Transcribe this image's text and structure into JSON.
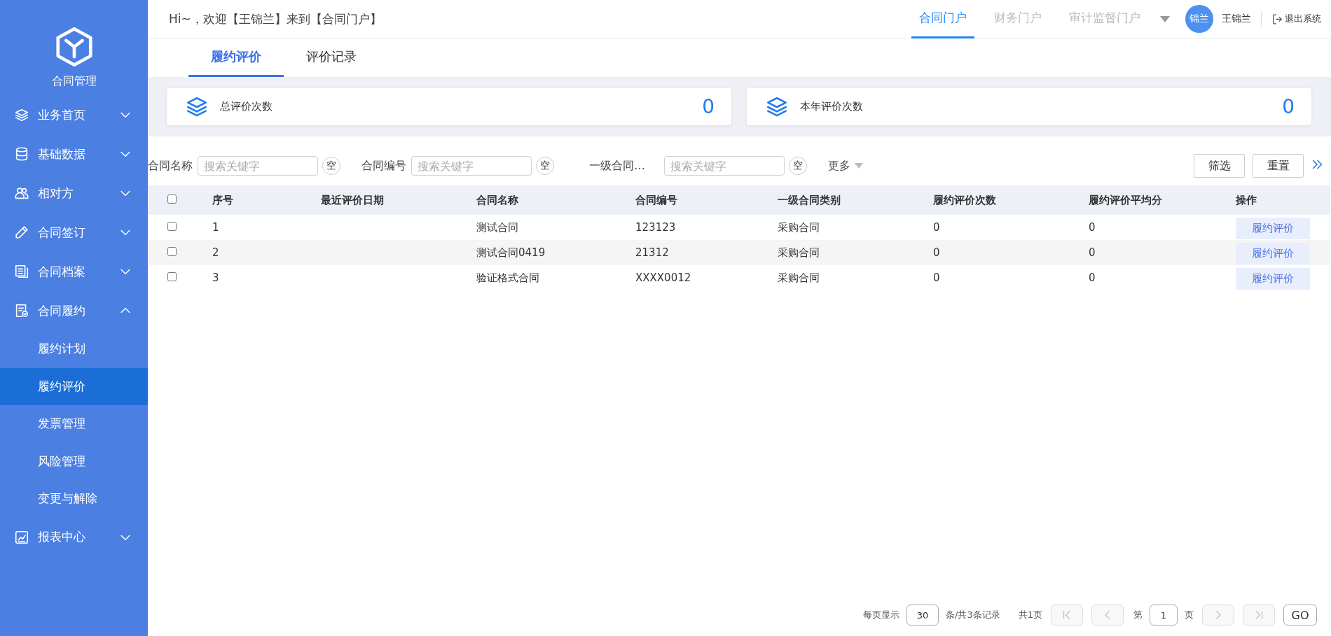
{
  "sidebar": {
    "logo_text": "合同管理",
    "items": [
      {
        "label": "业务首页",
        "expanded": false
      },
      {
        "label": "基础数据",
        "expanded": false
      },
      {
        "label": "相对方",
        "expanded": false
      },
      {
        "label": "合同签订",
        "expanded": false
      },
      {
        "label": "合同档案",
        "expanded": false
      },
      {
        "label": "合同履约",
        "expanded": true,
        "children": [
          {
            "label": "履约计划",
            "selected": false
          },
          {
            "label": "履约评价",
            "selected": true
          },
          {
            "label": "发票管理",
            "selected": false
          },
          {
            "label": "风险管理",
            "selected": false
          },
          {
            "label": "变更与解除",
            "selected": false
          }
        ]
      },
      {
        "label": "报表中心",
        "expanded": false
      }
    ]
  },
  "header": {
    "greeting": "Hi~，欢迎【王锦兰】来到【合同门户】",
    "portals": [
      {
        "label": "合同门户",
        "selected": true
      },
      {
        "label": "财务门户",
        "selected": false
      },
      {
        "label": "审计监督门户",
        "selected": false
      }
    ],
    "avatar": "锦兰",
    "user": "王锦兰",
    "logout": "退出系统"
  },
  "tabs": [
    {
      "label": "履约评价",
      "selected": true
    },
    {
      "label": "评价记录",
      "selected": false
    }
  ],
  "stats": [
    {
      "label": "总评价次数",
      "value": "0"
    },
    {
      "label": "本年评价次数",
      "value": "0"
    }
  ],
  "filters": {
    "fields": [
      {
        "label": "合同名称",
        "placeholder": "搜索关键字",
        "clear": "空"
      },
      {
        "label": "合同编号",
        "placeholder": "搜索关键字",
        "clear": "空"
      },
      {
        "label": "一级合同…",
        "placeholder": "搜索关键字",
        "clear": "空"
      }
    ],
    "more": "更多",
    "buttons": [
      "筛选",
      "重置"
    ]
  },
  "table": {
    "header_checked": false,
    "columns": [
      "序号",
      "最近评价日期",
      "合同名称",
      "合同编号",
      "一级合同类别",
      "履约评价次数",
      "履约评价平均分",
      "操作"
    ],
    "rows": [
      {
        "checked": false,
        "cells": [
          "1",
          null,
          "测试合同",
          "123123",
          "采购合同",
          "0",
          "0"
        ],
        "action": "履约评价"
      },
      {
        "checked": false,
        "cells": [
          "2",
          null,
          "测试合同0419",
          "21312",
          "采购合同",
          "0",
          "0"
        ],
        "action": "履约评价"
      },
      {
        "checked": false,
        "cells": [
          "3",
          null,
          "验证格式合同",
          "XXXX0012",
          "采购合同",
          "0",
          "0"
        ],
        "action": "履约评价"
      }
    ]
  },
  "pagination": {
    "per_page_label": "每页显示",
    "page_size": "30",
    "total_text": "条/共3条记录",
    "pages_text": "共1页",
    "page_prefix": "第",
    "page": "1",
    "page_suffix": "页",
    "go": "GO",
    "nav": [
      {
        "kind": "first",
        "disabled": true
      },
      {
        "kind": "prev",
        "disabled": true
      },
      {
        "kind": "next",
        "disabled": true
      },
      {
        "kind": "last",
        "disabled": true
      }
    ]
  }
}
